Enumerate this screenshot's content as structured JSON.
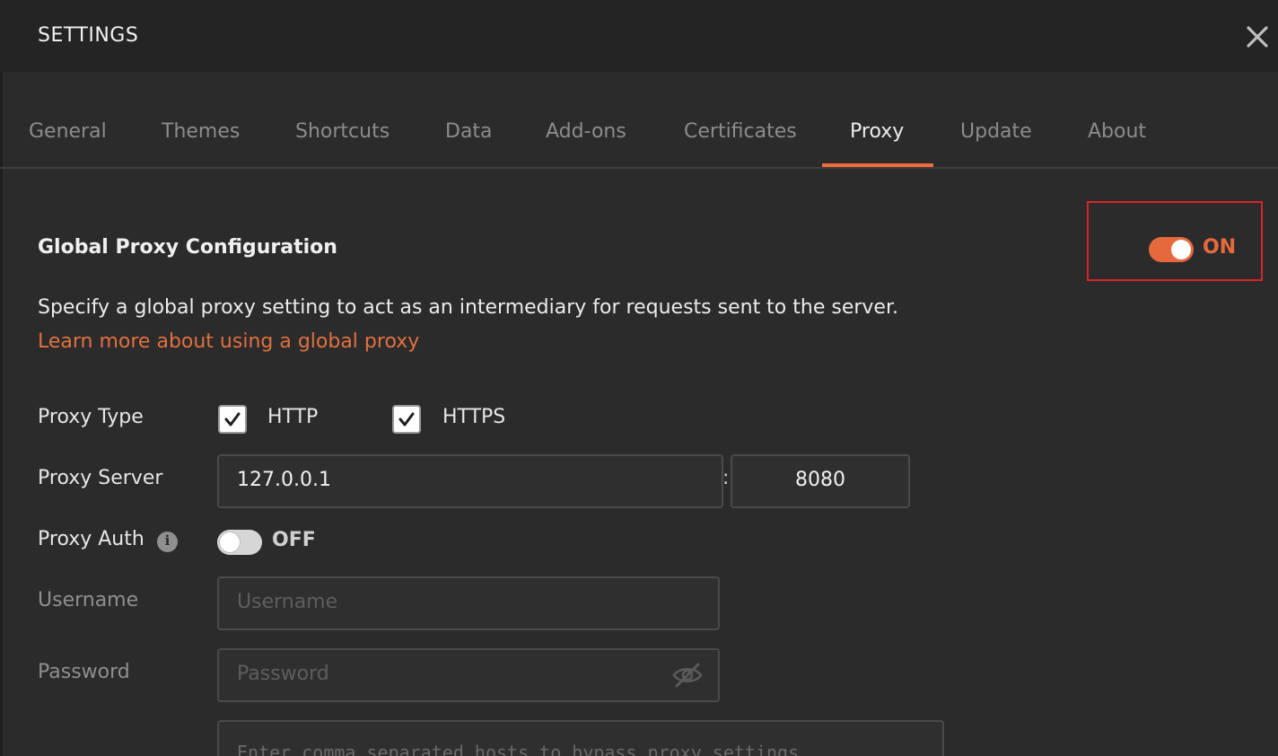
{
  "dialog": {
    "title": "SETTINGS",
    "close_icon": "close-icon"
  },
  "tabs": [
    {
      "label": "General"
    },
    {
      "label": "Themes"
    },
    {
      "label": "Shortcuts"
    },
    {
      "label": "Data"
    },
    {
      "label": "Add-ons"
    },
    {
      "label": "Certificates"
    },
    {
      "label": "Proxy",
      "active": true
    },
    {
      "label": "Update"
    },
    {
      "label": "About"
    }
  ],
  "proxy": {
    "section_title": "Global Proxy Configuration",
    "global_toggle": {
      "state": "on",
      "label": "ON"
    },
    "description": "Specify a global proxy setting to act as an intermediary for requests sent to the server.",
    "learn_more": "Learn more about using a global proxy",
    "proxy_type": {
      "label": "Proxy Type",
      "http": {
        "label": "HTTP",
        "checked": true
      },
      "https": {
        "label": "HTTPS",
        "checked": true
      }
    },
    "proxy_server": {
      "label": "Proxy Server",
      "host": "127.0.0.1",
      "separator": ":",
      "port": "8080"
    },
    "proxy_auth": {
      "label": "Proxy Auth",
      "info_icon": "info-icon",
      "info_glyph": "i",
      "toggle": {
        "state": "off",
        "label": "OFF"
      }
    },
    "username": {
      "label": "Username",
      "placeholder": "Username",
      "value": ""
    },
    "password": {
      "label": "Password",
      "placeholder": "Password",
      "value": "",
      "icon": "eye-slash-icon"
    },
    "bypass": {
      "placeholder": "Enter comma separated hosts to bypass proxy settings"
    }
  },
  "colors": {
    "accent": "#e6693e",
    "link": "#e0703f",
    "highlight_border": "#d8232a",
    "background": "#2b2b2b",
    "titlebar": "#242424"
  }
}
